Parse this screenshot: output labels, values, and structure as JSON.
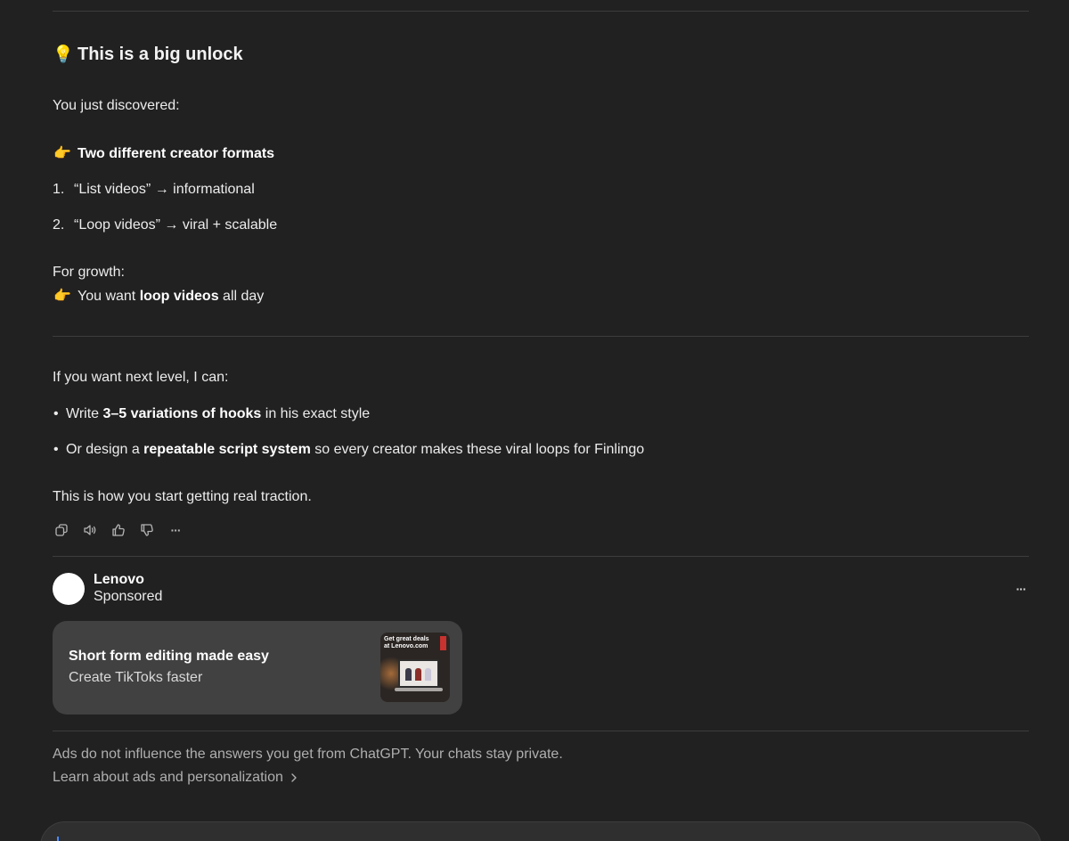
{
  "message": {
    "heading_emoji": "💡",
    "heading": "This is a big unlock",
    "intro": "You just discovered:",
    "formats_emoji": "👉",
    "formats_title": "Two different creator formats",
    "formats": [
      {
        "num": "1.",
        "text": "“List videos” → informational"
      },
      {
        "num": "2.",
        "text": "“Loop videos” → viral + scalable"
      }
    ],
    "growth_label": "For growth:",
    "growth_emoji": "👉",
    "growth_pre": "You want ",
    "growth_bold": "loop videos",
    "growth_post": " all day",
    "next_level": "If you want next level, I can:",
    "options": [
      {
        "bullet": "•",
        "pre": "Write ",
        "bold": "3–5 variations of hooks",
        "post": " in his exact style"
      },
      {
        "bullet": "•",
        "pre": "Or design a ",
        "bold": "repeatable script system",
        "post": " so every creator makes these viral loops for Finlingo"
      }
    ],
    "closing": "This is how you start getting real traction."
  },
  "actions": {
    "icons": [
      "copy-icon",
      "read-aloud-icon",
      "thumbs-up-icon",
      "thumbs-down-icon",
      "more-icon"
    ],
    "more_glyph": "···"
  },
  "ad": {
    "advertiser": "Lenovo",
    "sponsored": "Sponsored",
    "more_glyph": "···",
    "title": "Short form editing made easy",
    "subtitle": "Create TikToks faster",
    "thumb_text": "Get great deals at Lenovo.com"
  },
  "disclaimer": {
    "text": "Ads do not influence the answers you get from ChatGPT. Your chats stay private.",
    "link": "Learn about ads and personalization",
    "link_icon": "chevron-right-icon"
  },
  "colors": {
    "background": "#212121",
    "card": "#414141",
    "divider": "#3d3d3d",
    "muted_text": "#afafaf"
  }
}
